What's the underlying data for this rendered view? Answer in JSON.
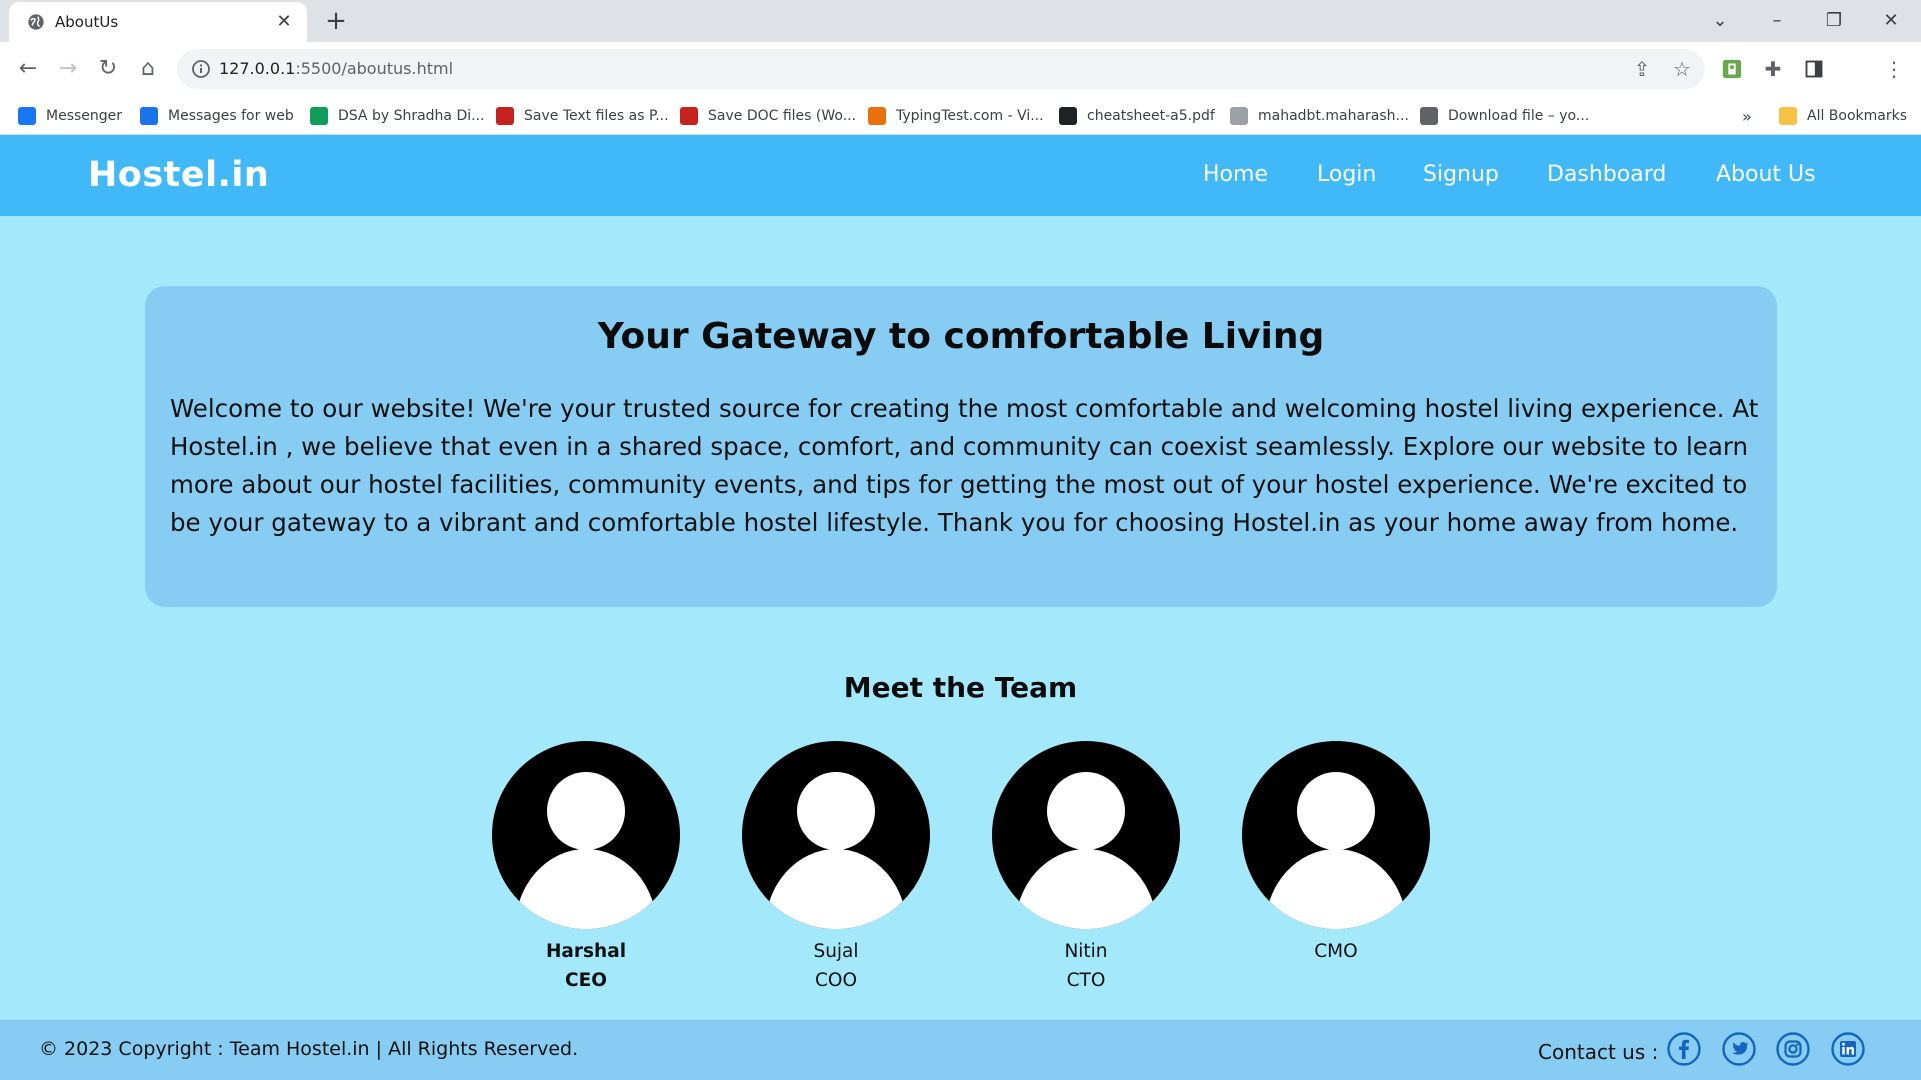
{
  "browser": {
    "tab_title": "AboutUs",
    "url_host": "127.0.0.1",
    "url_path": ":5500/aboutus.html",
    "bookmarks": [
      {
        "label": "Messenger",
        "icon": "facebook-icon",
        "color": "#1877f2"
      },
      {
        "label": "Messages for web",
        "icon": "messages-icon",
        "color": "#1a73e8"
      },
      {
        "label": "DSA by Shradha Di...",
        "icon": "sheets-icon",
        "color": "#0f9d58"
      },
      {
        "label": "Save Text files as P...",
        "icon": "pdf-icon",
        "color": "#c5221f"
      },
      {
        "label": "Save DOC files (Wo...",
        "icon": "pdf-icon",
        "color": "#c5221f"
      },
      {
        "label": "TypingTest.com - Vi...",
        "icon": "typingtest-icon",
        "color": "#e8710a"
      },
      {
        "label": "cheatsheet-a5.pdf",
        "icon": "cheatsheet-icon",
        "color": "#202124"
      },
      {
        "label": "mahadbt.maharash...",
        "icon": "document-icon",
        "color": "#9aa0a6"
      },
      {
        "label": "Download file – yo...",
        "icon": "download-icon",
        "color": "#5f6368"
      }
    ],
    "more_bookmarks": "»",
    "all_bookmarks": "All Bookmarks"
  },
  "navbar": {
    "brand": "Hostel.in",
    "links": [
      "Home",
      "Login",
      "Signup",
      "Dashboard",
      "About Us"
    ]
  },
  "hero": {
    "title": "Your Gateway to comfortable Living",
    "paragraph": "Welcome to our website! We're your trusted source for creating the most comfortable and welcoming hostel living experience. At Hostel.in , we believe that even in a shared space, comfort, and community can coexist seamlessly. Explore our website to learn more about our hostel facilities, community events, and tips for getting the most out of your hostel experience. We're excited to be your gateway to a vibrant and comfortable hostel lifestyle. Thank you for choosing Hostel.in as your home away from home."
  },
  "team": {
    "title": "Meet the Team",
    "members": [
      {
        "name": "Harshal",
        "role": "CEO"
      },
      {
        "name": "Sujal",
        "role": "COO"
      },
      {
        "name": "Nitin",
        "role": "CTO"
      },
      {
        "name": "",
        "role": "CMO"
      }
    ]
  },
  "footer": {
    "copyright": "© 2023 Copyright : Team Hostel.in | All Rights Reserved.",
    "contact_label": "Contact us :",
    "social": [
      "facebook-icon",
      "twitter-icon",
      "instagram-icon",
      "linkedin-icon"
    ]
  },
  "colors": {
    "navbar": "#41b9f8",
    "page_bg": "#a4e8fc",
    "card_bg": "#87cdf3",
    "social_blue": "#1565c0"
  }
}
